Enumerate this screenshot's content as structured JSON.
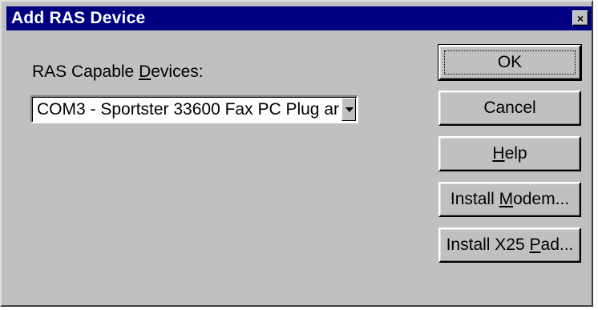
{
  "window": {
    "title": "Add RAS Device",
    "close_glyph": "×"
  },
  "devices": {
    "label_pre": "RAS Capable ",
    "label_mn": "D",
    "label_post": "evices:",
    "selected": "COM3 - Sportster 33600 Fax PC Plug ar"
  },
  "buttons": {
    "ok": "OK",
    "cancel": "Cancel",
    "help_mn": "H",
    "help_post": "elp",
    "modem_pre": "Install ",
    "modem_mn": "M",
    "modem_post": "odem...",
    "x25_pre": "Install X25 ",
    "x25_mn": "P",
    "x25_post": "ad..."
  }
}
